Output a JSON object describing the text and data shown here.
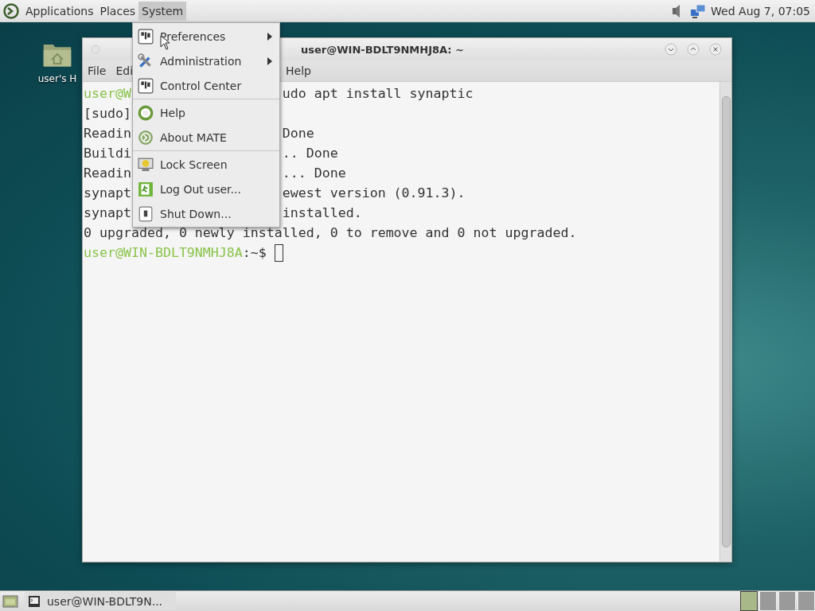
{
  "top_panel": {
    "menus": [
      {
        "label": "Applications",
        "selected": false
      },
      {
        "label": "Places",
        "selected": false
      },
      {
        "label": "System",
        "selected": true
      }
    ],
    "clock": "Wed Aug 7, 07:05"
  },
  "desktop": {
    "icons": [
      {
        "label": "user's H"
      }
    ]
  },
  "terminal": {
    "title": "user@WIN-BDLT9NMHJ8A: ~",
    "menubar": [
      "File",
      "Edi",
      "Help"
    ],
    "lines": [
      {
        "kind": "prompt",
        "left": "user@W",
        "right": "udo apt install synaptic"
      },
      {
        "kind": "output",
        "left": "[sudo]"
      },
      {
        "kind": "output",
        "left": "Readin",
        "right": "Done"
      },
      {
        "kind": "output",
        "left": "Buildi",
        "right": ".. Done"
      },
      {
        "kind": "output",
        "left": "Readin",
        "right": "... Done"
      },
      {
        "kind": "output",
        "left": "synapt",
        "right": "ewest version (0.91.3)."
      },
      {
        "kind": "output",
        "left": "synapt",
        "right": "installed."
      },
      {
        "kind": "output",
        "left": "0 upgraded, 0 newly installed, 0 to remove and 0 not upgraded."
      },
      {
        "kind": "input",
        "left": "user@WIN-BDLT9NMHJ8A",
        "right": ":~$"
      }
    ]
  },
  "system_menu": {
    "groups": [
      {
        "items": [
          {
            "label": "Preferences",
            "submenu": true
          },
          {
            "label": "Administration",
            "submenu": true
          },
          {
            "label": "Control Center",
            "submenu": false
          }
        ]
      },
      {
        "items": [
          {
            "label": "Help",
            "submenu": false
          },
          {
            "label": "About MATE",
            "submenu": false
          }
        ]
      },
      {
        "items": [
          {
            "label": "Lock Screen",
            "submenu": false
          },
          {
            "label": "Log Out user...",
            "submenu": false
          },
          {
            "label": "Shut Down...",
            "submenu": false
          }
        ]
      }
    ]
  },
  "bottom_panel": {
    "tasks": [
      {
        "label": "user@WIN-BDLT9N...",
        "selected": false
      }
    ],
    "workspaces": [
      {
        "selected": true
      },
      {
        "selected": false
      },
      {
        "selected": false
      },
      {
        "selected": false
      }
    ]
  }
}
